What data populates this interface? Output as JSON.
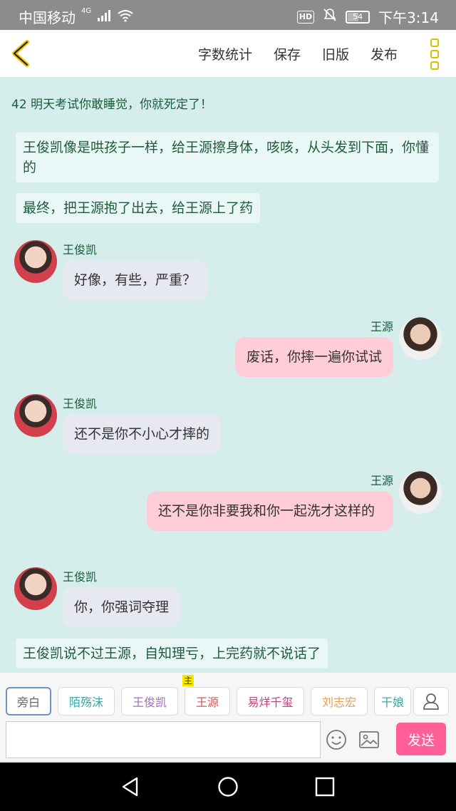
{
  "status_bar": {
    "carrier": "中国移动",
    "network": "4G",
    "hd": "HD",
    "battery": "54",
    "time": "下午3:14"
  },
  "toolbar": {
    "items": [
      "字数统计",
      "保存",
      "旧版",
      "发布"
    ]
  },
  "chat": {
    "chapter_title": "42 明天考试你敢睡觉，你就死定了！",
    "narrations": [
      "王俊凯像是哄孩子一样，给王源擦身体，咳咳，从头发到下面，你懂的",
      "最终，把王源抱了出去，给王源上了药",
      "王俊凯说不过王源，自知理亏，上完药就不说话了"
    ],
    "messages": [
      {
        "speaker": "王俊凯",
        "text": "好像，有些，严重？"
      },
      {
        "speaker": "王源",
        "text": "废话，你摔一遍你试试"
      },
      {
        "speaker": "王俊凯",
        "text": "还不是你不小心才摔的"
      },
      {
        "speaker": "王源",
        "text": "还不是你非要我和你一起洗才这样的"
      },
      {
        "speaker": "王俊凯",
        "text": "你，你强词夺理"
      }
    ]
  },
  "role_bar": {
    "tabs": [
      {
        "label": "旁白",
        "color": "#888888"
      },
      {
        "label": "陌殇沫",
        "color": "#3aa7a3"
      },
      {
        "label": "王俊凯",
        "color": "#a56bc0"
      },
      {
        "label": "王源",
        "color": "#d9534f"
      },
      {
        "label": "易烊千玺",
        "color": "#c0407f"
      },
      {
        "label": "刘志宏",
        "color": "#e0a060"
      },
      {
        "label": "干娘",
        "color": "#3aa7a3"
      }
    ],
    "main_badge": "主",
    "input_placeholder": "",
    "send_label": "发送"
  }
}
